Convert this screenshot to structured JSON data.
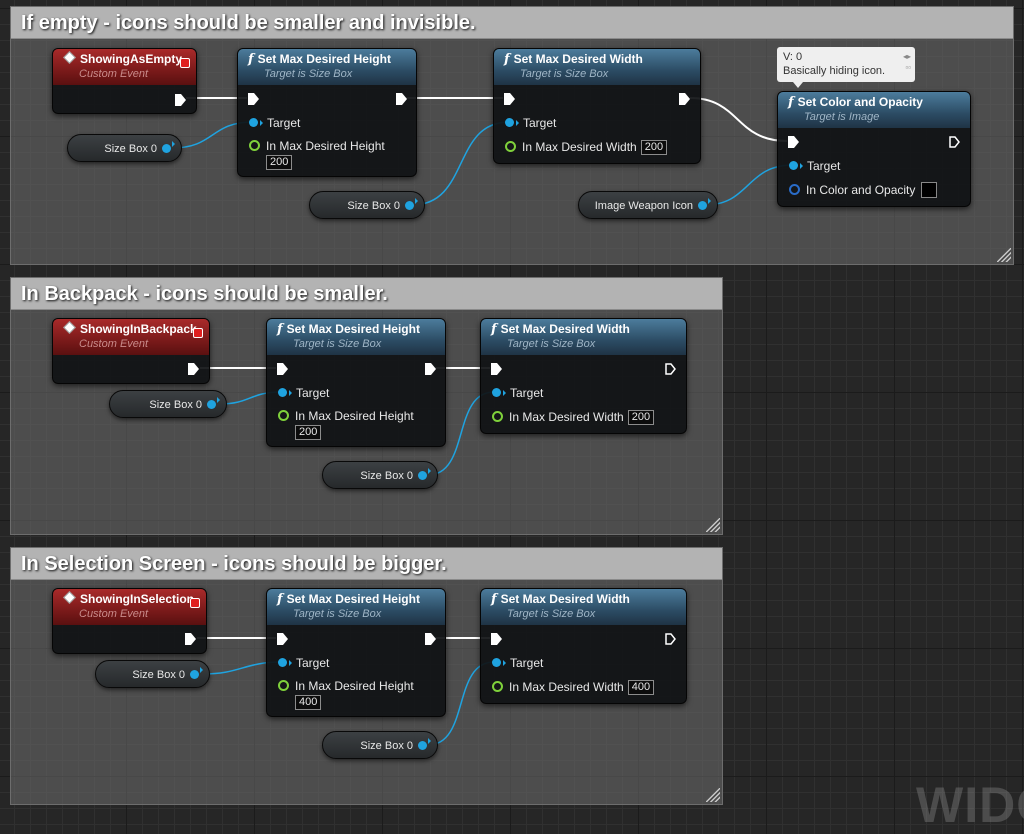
{
  "comments": [
    {
      "title": "If empty - icons should be smaller and invisible."
    },
    {
      "title": "In Backpack - icons should be smaller."
    },
    {
      "title": "In Selection Screen - icons should be bigger."
    }
  ],
  "event_subtitle": "Custom Event",
  "events": [
    {
      "name": "ShowingAsEmpty"
    },
    {
      "name": "ShowingInBackpack"
    },
    {
      "name": "ShowingInSelection"
    }
  ],
  "functions": {
    "height_title": "Set Max Desired Height",
    "width_title": "Set Max Desired Width",
    "target_sizebox": "Target is Size Box",
    "color_title": "Set Color and Opacity",
    "target_image": "Target is Image"
  },
  "pins": {
    "target": "Target",
    "height": "In Max Desired Height",
    "width": "In Max Desired Width",
    "color": "In Color and Opacity"
  },
  "values": {
    "empty_height": "200",
    "empty_width": "200",
    "backpack_height": "200",
    "backpack_width": "200",
    "selection_height": "400",
    "selection_width": "400"
  },
  "variables": {
    "size_box": "Size Box 0",
    "image_weapon_icon": "Image Weapon Icon"
  },
  "node_comment": {
    "line1": "V: 0",
    "line2": "Basically hiding icon."
  },
  "watermark": "WIDG",
  "colors": {
    "object_pin": "#1fa3e0",
    "float_pin": "#7fd13b",
    "struct_pin": "#2a6cc8",
    "event_header": "#a92a2a",
    "function_header": "#4c7c9c",
    "exec_wire": "#ffffff"
  },
  "icons": [
    "function-icon",
    "event-icon",
    "delegate-pin-icon",
    "exec-pin-icon",
    "resize-handle-icon"
  ]
}
